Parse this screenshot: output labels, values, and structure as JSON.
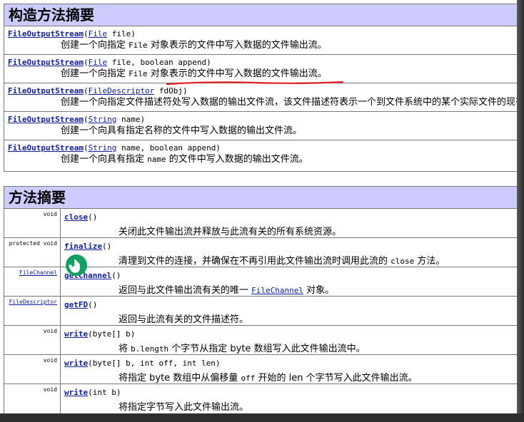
{
  "constructors": {
    "title": "构造方法摘要",
    "rows": [
      {
        "name": "FileOutputStream",
        "open": "(",
        "type": "File",
        "rest": " file)",
        "d1": "创建一个向指定 ",
        "code": "File",
        "d2": " 对象表示的文件中写入数据的文件输出流。"
      },
      {
        "name": "FileOutputStream",
        "open": "(",
        "type": "File",
        "rest": " file, boolean append)",
        "d1": "创建一个向指定 ",
        "code": "File",
        "d2": " 对象表示的文件中写入数据的文件输出流。"
      },
      {
        "name": "FileOutputStream",
        "open": "(",
        "type": "FileDescriptor",
        "rest": " fdObj)",
        "d1": "创建一个向指定文件描述符处写入数据的输出文件流，该文件描述符表示一个到文件系统中的某个实际文件的现有连接。",
        "code": "",
        "d2": ""
      },
      {
        "name": "FileOutputStream",
        "open": "(",
        "type": "String",
        "rest": " name)",
        "d1": "创建一个向具有指定名称的文件中写入数据的输出文件流。",
        "code": "",
        "d2": ""
      },
      {
        "name": "FileOutputStream",
        "open": "(",
        "type": "String",
        "rest": " name, boolean append)",
        "d1": "创建一个向具有指定 ",
        "code": "name",
        "d2": " 的文件中写入数据的输出文件流。"
      }
    ]
  },
  "methods": {
    "title": "方法摘要",
    "rows": [
      {
        "mod": "void",
        "mod_link": false,
        "name": "close",
        "params": "()",
        "d1": "关闭此文件输出流并释放与此流有关的所有系统资源。",
        "code": "",
        "d2": ""
      },
      {
        "mod": "protected  void",
        "mod_link": false,
        "name": "finalize",
        "params": "()",
        "d1": "清理到文件的连接，并确保在不再引用此文件输出流时调用此流的 ",
        "code": "close",
        "d2": " 方法。"
      },
      {
        "mod": "FileChannel",
        "mod_link": true,
        "name": "getChannel",
        "params": "()",
        "d1": "返回与此文件输出流有关的唯一 ",
        "code": "FileChannel",
        "d2": " 对象。",
        "code_link": true
      },
      {
        "mod": "FileDescriptor",
        "mod_link": true,
        "name": "getFD",
        "params": "()",
        "d1": "返回与此流有关的文件描述符。",
        "code": "",
        "d2": ""
      },
      {
        "mod": "void",
        "mod_link": false,
        "name": "write",
        "params": "(byte[] b)",
        "d1": "将 ",
        "code": "b.length",
        "d2": " 个字节从指定 byte 数组写入此文件输出流中。"
      },
      {
        "mod": "void",
        "mod_link": false,
        "name": "write",
        "params": "(byte[] b, int off, int len)",
        "d1": "将指定 byte 数组中从偏移量 ",
        "code": "off",
        "d2": " 开始的 len 个字节写入此文件输出流。"
      },
      {
        "mod": "void",
        "mod_link": false,
        "name": "write",
        "params": "(int b)",
        "d1": "将指定字节写入此文件输出流。",
        "code": "",
        "d2": ""
      }
    ]
  },
  "colors": {
    "header_bg": "#ccccff",
    "link": "#1020a0",
    "annotation": "#e02020",
    "cursor_badge": "#12a060"
  },
  "icons": {
    "cursor": "hand-pointer-icon"
  }
}
